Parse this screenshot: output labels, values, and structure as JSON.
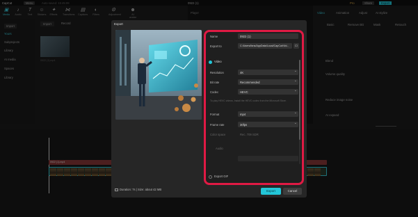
{
  "app": {
    "name": "CapCut",
    "menu": "Menu",
    "auto_saved": "Auto saved: 15:45:08",
    "project_name": "0922 (1)",
    "top_buttons": [
      "Pro",
      "Share",
      "Export"
    ]
  },
  "toolbar": {
    "items": [
      "Media",
      "Audio",
      "Text",
      "Stickers",
      "Effects",
      "Transitions",
      "Captions",
      "Filters",
      "Adjustment",
      "AI avatar"
    ]
  },
  "left_nav": {
    "items": [
      "Import",
      "Yours",
      "Subprojects",
      "Library",
      "AI media",
      "Spaces",
      "Library"
    ]
  },
  "media": {
    "import_label": "Import",
    "record_label": "Record",
    "clip_name": "0922 (1).mp4"
  },
  "player_label": "Player",
  "right_panel": {
    "tabs": [
      "Video",
      "Animation",
      "Adjust",
      "AI stylize"
    ],
    "subtabs": [
      "Basic",
      "Remove BG",
      "Mask",
      "Retouch"
    ],
    "rows": [
      "Blend",
      "Volume quality",
      "Reduce image noise",
      "AI expand"
    ]
  },
  "dialog": {
    "title": "Export",
    "duration_text": "Duration: 7s | Size: about 42 MB",
    "name_label": "Name",
    "name_value": "0922 (1)",
    "export_to_label": "Export to",
    "export_to_value": "C:/Users/fans/AppData/Local/CapCut/Vid...",
    "video_section": "Video",
    "resolution_label": "Resolution",
    "resolution_value": "4K",
    "bitrate_label": "Bit rate",
    "bitrate_value": "Recommended",
    "codec_label": "Codec",
    "codec_value": "HEVC",
    "hint": "To play HEVC videos, install the HEVC codec from the Microsoft Store.",
    "format_label": "Format",
    "format_value": "mp4",
    "framerate_label": "Frame rate",
    "framerate_value": "30fps",
    "color_label": "Color space",
    "color_value": "Rec. 709 SDR",
    "audio_section": "Audio",
    "export_gif_label": "Export GIF",
    "export_button": "Export",
    "cancel_button": "Cancel"
  },
  "timeline": {
    "clip_label": "0922 (1).mp4"
  },
  "colors": {
    "accent": "#23c6d8",
    "highlight_border": "#e01a44",
    "dialog_bg": "#262626"
  }
}
